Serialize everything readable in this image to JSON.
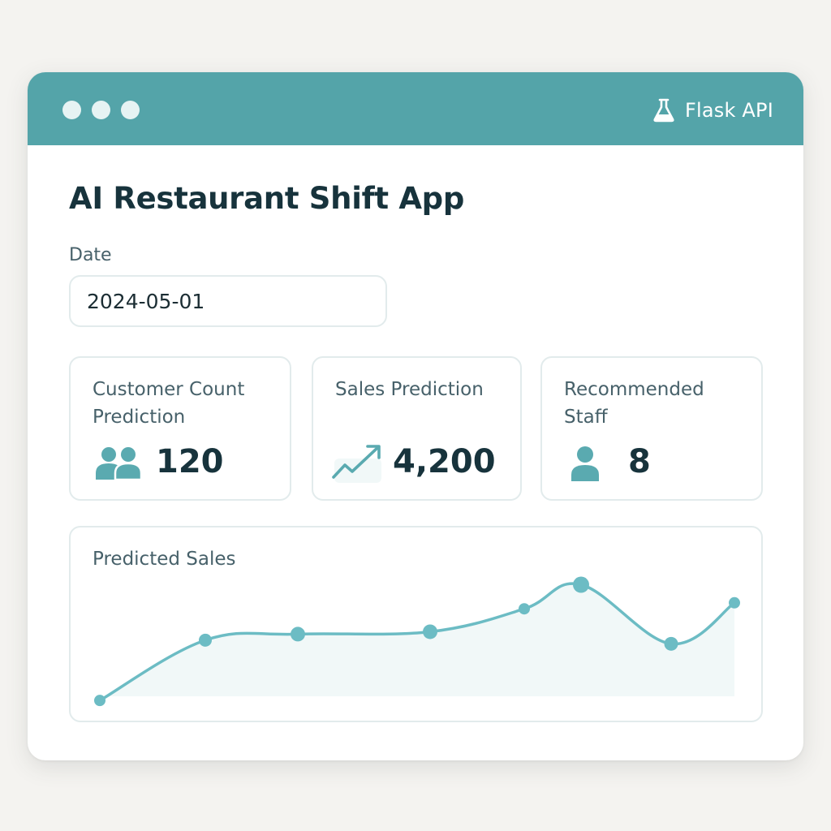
{
  "window": {
    "api_label": "Flask API",
    "api_icon": "flask-icon",
    "traffic_dots": [
      "dot",
      "dot",
      "dot"
    ]
  },
  "app": {
    "title": "AI Restaurant Shift App"
  },
  "date_field": {
    "label": "Date",
    "value": "2024-05-01"
  },
  "cards": [
    {
      "label": "Customer Count Prediction",
      "value": "120",
      "icon": "users-icon"
    },
    {
      "label": "Sales Prediction",
      "value": "4,200",
      "icon": "trending-up-icon"
    },
    {
      "label": "Recommended Staff",
      "value": "8",
      "icon": "user-icon"
    }
  ],
  "chart": {
    "title": "Predicted Sales"
  },
  "colors": {
    "accent": "#54a4a9",
    "line": "#6cbcc4",
    "area": "#f1f8f8",
    "text_dark": "#17333c",
    "text_muted": "#47616a"
  },
  "chart_data": {
    "type": "area",
    "title": "Predicted Sales",
    "xlabel": "",
    "ylabel": "",
    "grid": false,
    "x": [
      1,
      2,
      3,
      4,
      5,
      6,
      7,
      8
    ],
    "values": [
      10,
      60,
      65,
      67,
      86,
      106,
      57,
      91
    ],
    "ylim": [
      0,
      140
    ]
  }
}
